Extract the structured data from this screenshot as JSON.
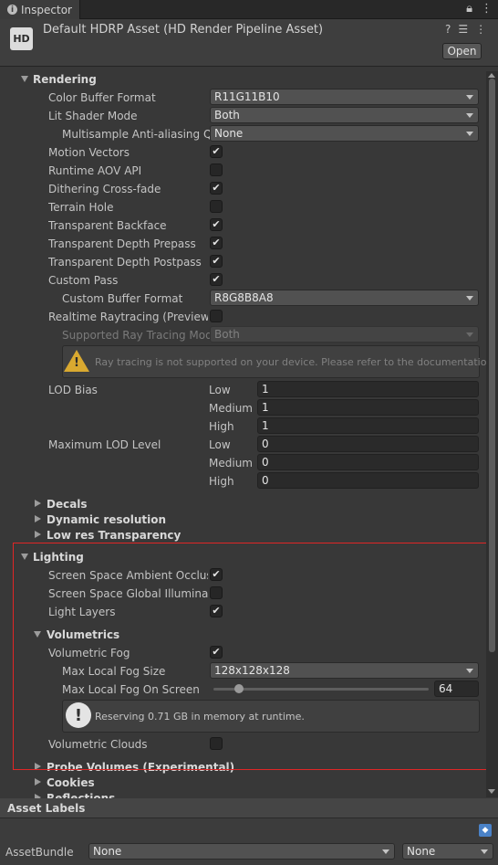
{
  "tab": {
    "title": "Inspector"
  },
  "header": {
    "icon_text": "HD",
    "title": "Default HDRP Asset (HD Render Pipeline Asset)",
    "open_label": "Open"
  },
  "rendering": {
    "title": "Rendering",
    "color_buffer_format": {
      "label": "Color Buffer Format",
      "value": "R11G11B10"
    },
    "lit_shader_mode": {
      "label": "Lit Shader Mode",
      "value": "Both"
    },
    "msaa": {
      "label": "Multisample Anti-aliasing Quality",
      "value": "None"
    },
    "motion_vectors": {
      "label": "Motion Vectors",
      "checked": true
    },
    "runtime_aov": {
      "label": "Runtime AOV API",
      "checked": false
    },
    "dithering": {
      "label": "Dithering Cross-fade",
      "checked": true
    },
    "terrain_hole": {
      "label": "Terrain Hole",
      "checked": false
    },
    "transparent_backface": {
      "label": "Transparent Backface",
      "checked": true
    },
    "transparent_depth_prepass": {
      "label": "Transparent Depth Prepass",
      "checked": true
    },
    "transparent_depth_postpass": {
      "label": "Transparent Depth Postpass",
      "checked": true
    },
    "custom_pass": {
      "label": "Custom Pass",
      "checked": true
    },
    "custom_buffer_format": {
      "label": "Custom Buffer Format",
      "value": "R8G8B8A8"
    },
    "realtime_raytracing": {
      "label": "Realtime Raytracing (Preview)",
      "checked": false
    },
    "supported_ray_tracing_mode": {
      "label": "Supported Ray Tracing Mode",
      "value": "Both"
    },
    "raytracing_warning": "Ray tracing is not supported on your device. Please refer to the documentation.",
    "lod_bias": {
      "label": "LOD Bias",
      "low_label": "Low",
      "low": "1",
      "medium_label": "Medium",
      "medium": "1",
      "high_label": "High",
      "high": "1"
    },
    "max_lod": {
      "label": "Maximum LOD Level",
      "low_label": "Low",
      "low": "0",
      "medium_label": "Medium",
      "medium": "0",
      "high_label": "High",
      "high": "0"
    },
    "decals": "Decals",
    "dynamic_resolution": "Dynamic resolution",
    "low_res_transparency": "Low res Transparency"
  },
  "lighting": {
    "title": "Lighting",
    "ssao": {
      "label": "Screen Space Ambient Occlusion",
      "checked": true
    },
    "ssgi": {
      "label": "Screen Space Global Illumination",
      "checked": false
    },
    "light_layers": {
      "label": "Light Layers",
      "checked": true
    },
    "volumetrics": {
      "title": "Volumetrics",
      "volumetric_fog": {
        "label": "Volumetric Fog",
        "checked": true
      },
      "max_local_fog_size": {
        "label": "Max Local Fog Size",
        "value": "128x128x128"
      },
      "max_local_fog_on_screen": {
        "label": "Max Local Fog On Screen",
        "value": "64",
        "fraction": 0.12
      },
      "memory_info": "Reserving 0.71 GB in memory at runtime.",
      "volumetric_clouds": {
        "label": "Volumetric Clouds",
        "checked": false
      }
    }
  },
  "more_sections": {
    "probe_volumes": "Probe Volumes (Experimental)",
    "cookies": "Cookies",
    "reflections": "Reflections"
  },
  "asset_labels": {
    "title": "Asset Labels",
    "assetbundle_label": "AssetBundle",
    "assetbundle_value": "None",
    "variant_value": "None"
  },
  "colors": {
    "background": "#383838",
    "highlight_box": "#e02626",
    "warning": "#d9a930"
  },
  "icons": {
    "tab": "info-icon",
    "lock": "lock-icon",
    "menu": "kebab-menu-icon",
    "help": "help-icon",
    "settings": "sliders-icon",
    "warning": "warning-icon",
    "info": "info-icon",
    "tag": "tag-icon"
  }
}
